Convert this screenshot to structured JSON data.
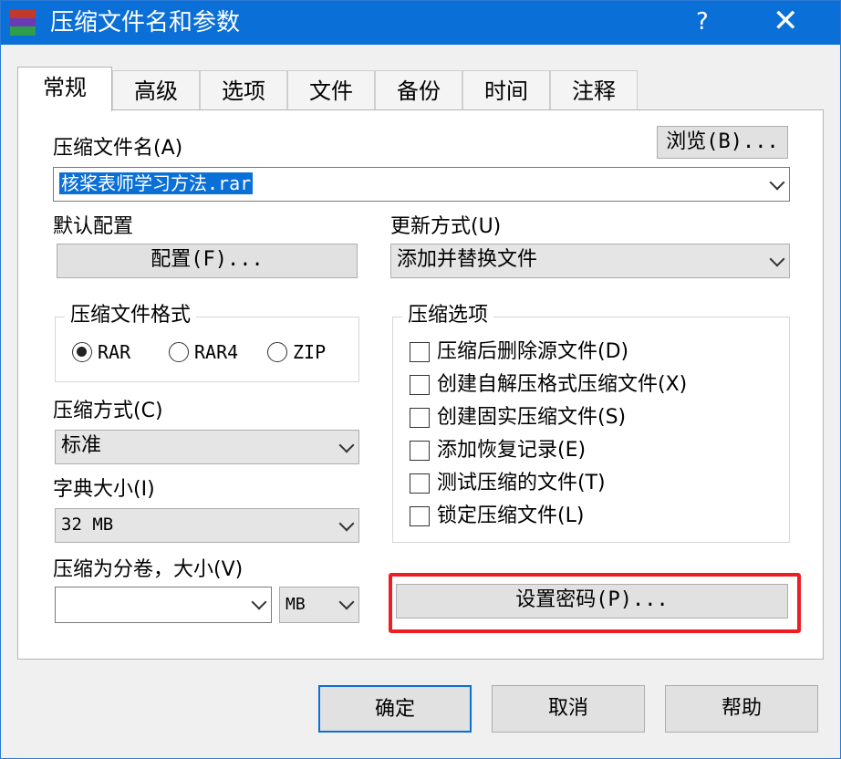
{
  "window": {
    "title": "压缩文件名和参数",
    "help_glyph": "?",
    "close_glyph": "✕",
    "accent_color": "#0a6fd6"
  },
  "tabs": [
    "常规",
    "高级",
    "选项",
    "文件",
    "备份",
    "时间",
    "注释"
  ],
  "archive_name": {
    "label": "压缩文件名(A)",
    "value": "核桨表师学习方法.rar",
    "browse_button": "浏览(B)..."
  },
  "default_profile": {
    "label": "默认配置",
    "button": "配置(F)..."
  },
  "update_mode": {
    "label": "更新方式(U)",
    "value": "添加并替换文件"
  },
  "archive_format": {
    "label": "压缩文件格式",
    "options": [
      {
        "label": "RAR",
        "selected": true
      },
      {
        "label": "RAR4",
        "selected": false
      },
      {
        "label": "ZIP",
        "selected": false
      }
    ]
  },
  "compression_method": {
    "label": "压缩方式(C)",
    "value": "标准"
  },
  "dictionary_size": {
    "label": "字典大小(I)",
    "value": "32 MB"
  },
  "split_volumes": {
    "label": "压缩为分卷，大小(V)",
    "value": "",
    "unit": "MB"
  },
  "archive_options": {
    "label": "压缩选项",
    "items": [
      "压缩后删除源文件(D)",
      "创建自解压格式压缩文件(X)",
      "创建固实压缩文件(S)",
      "添加恢复记录(E)",
      "测试压缩的文件(T)",
      "锁定压缩文件(L)"
    ]
  },
  "set_password_button": "设置密码(P)...",
  "footer": {
    "ok": "确定",
    "cancel": "取消",
    "help": "帮助"
  }
}
